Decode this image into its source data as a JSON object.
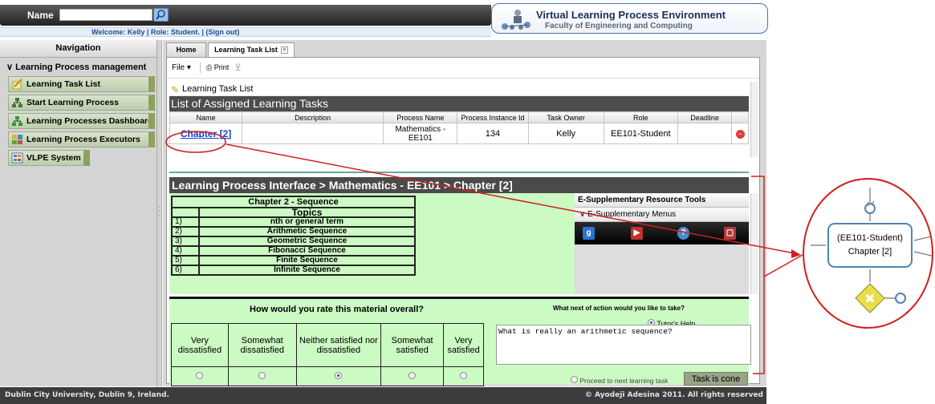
{
  "header": {
    "name_label": "Name",
    "name_value": "",
    "welcome": "Welcome: Kelly | Role: Student. | (Sign out)",
    "brand_title": "Virtual Learning Process Environment",
    "brand_subtitle": "Faculty of Engineering and Computing"
  },
  "sidebar": {
    "title": "Navigation",
    "group": "Learning Process management",
    "items": [
      {
        "label": "Learning Task List"
      },
      {
        "label": "Start Learning Process"
      },
      {
        "label": "Learning Processes Dashboard"
      },
      {
        "label": "Learning Process Executors"
      },
      {
        "label": "VLPE System"
      }
    ]
  },
  "tabs": [
    {
      "label": "Home"
    },
    {
      "label": "Learning Task List"
    }
  ],
  "toolbar": {
    "file": "File",
    "print": "Print"
  },
  "task_list": {
    "title": "Learning Task List",
    "heading": "List of Assigned Learning Tasks",
    "columns": [
      "Name",
      "Description",
      "Process Name",
      "Process Instance Id",
      "Task Owner",
      "Role",
      "Deadline"
    ],
    "row": {
      "name": "Chapter [2]",
      "description": "",
      "process_name": "Mathematics - EE101",
      "instance_id": "134",
      "owner": "Kelly",
      "role": "EE101-Student",
      "deadline": ""
    }
  },
  "interface": {
    "heading": "Learning Process Interface > Mathematics - EE101 > Chapter [2]",
    "chapter_title": "Chapter 2 - Sequence",
    "topics_header": "Topics",
    "topics": [
      {
        "num": "1)",
        "label": "nth or general term"
      },
      {
        "num": "2)",
        "label": "Arithmetic Sequence"
      },
      {
        "num": "3)",
        "label": "Geometric Sequence"
      },
      {
        "num": "4)",
        "label": "Fibonacci Sequence"
      },
      {
        "num": "5)",
        "label": "Finite Sequence"
      },
      {
        "num": "6)",
        "label": "Infinite Sequence"
      }
    ],
    "supp_title": "E-Supplementary Resource Tools",
    "supp_menus": "E-Supplementary Menus"
  },
  "rating": {
    "question": "How would you rate this material overall?",
    "options": [
      "Very dissatisfied",
      "Somewhat dissatisfied",
      "Neither satisfied nor dissatisfied",
      "Somewhat satisfied",
      "Very satisfied"
    ],
    "selected_index": 2
  },
  "next_action": {
    "question": "What next of action would you like to take?",
    "tutor_help": "Tutor's Help",
    "help_text": "What is really an arithmetic sequence?",
    "proceed": "Proceed to next learning task",
    "done": "Task is cone"
  },
  "footer": {
    "left": "Dublin City University, Dublin 9, Ireland.",
    "right": "© Ayodeji Adesina 2011. All rights reserved"
  },
  "annotation": {
    "box_line1": "(EE101-Student)",
    "box_line2": "Chapter [2]",
    "tr4": "tr4"
  },
  "colors": {
    "accent_red": "#d21e1e",
    "lp_green": "#cbfac3",
    "link_blue": "#1e3fd0"
  }
}
